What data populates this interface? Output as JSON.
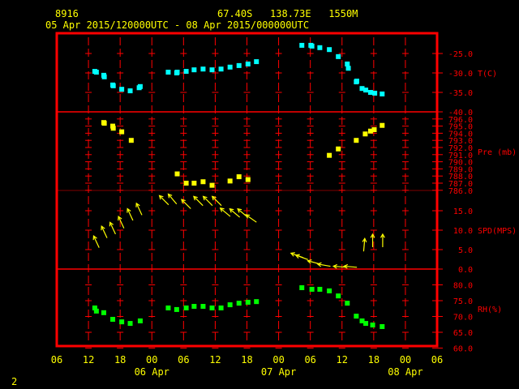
{
  "header": {
    "station": "8916",
    "location": "67.40S   138.73E   1550M",
    "period": "05 Apr 2015/120000UTC - 08 Apr 2015/000000UTC"
  },
  "page_number": "2",
  "colors": {
    "frame": "#ff0000",
    "temp": "#00ffff",
    "pressure": "#ffff00",
    "wind": "#ffff00",
    "rh": "#00ff00",
    "text": "#ffff00"
  },
  "chart_data": [
    {
      "type": "scatter",
      "name": "temperature",
      "ylabel": "T(C)",
      "ylim": [
        -40,
        -19.8
      ],
      "ticks": [
        "-25.0",
        "-30.0",
        "-35.0",
        "-40.0"
      ],
      "tick_values": [
        -25,
        -30,
        -35,
        -40
      ],
      "x_units": "hours since 05 Apr 06UTC",
      "points": [
        [
          7.2,
          -29.6
        ],
        [
          7.5,
          -29.8
        ],
        [
          8.9,
          -30.6
        ],
        [
          9.0,
          -31.0
        ],
        [
          10.6,
          -33.1
        ],
        [
          10.7,
          -33.3
        ],
        [
          12.3,
          -34.2
        ],
        [
          13.9,
          -34.6
        ],
        [
          15.6,
          -33.8
        ],
        [
          15.8,
          -33.5
        ],
        [
          21.1,
          -29.8
        ],
        [
          22.7,
          -30.0
        ],
        [
          22.8,
          -29.8
        ],
        [
          24.5,
          -29.6
        ],
        [
          26.0,
          -29.2
        ],
        [
          27.7,
          -29.0
        ],
        [
          29.4,
          -29.2
        ],
        [
          31.1,
          -29.0
        ],
        [
          32.8,
          -28.5
        ],
        [
          34.5,
          -28.1
        ],
        [
          36.2,
          -27.7
        ],
        [
          37.8,
          -27.1
        ],
        [
          46.4,
          -22.9
        ],
        [
          48.1,
          -22.9
        ],
        [
          48.3,
          -23.1
        ],
        [
          49.8,
          -23.5
        ],
        [
          51.6,
          -24.0
        ],
        [
          53.3,
          -25.8
        ],
        [
          55.0,
          -27.7
        ],
        [
          55.2,
          -28.8
        ],
        [
          56.7,
          -32.3
        ],
        [
          56.8,
          -32.1
        ],
        [
          57.8,
          -34.0
        ],
        [
          58.5,
          -34.4
        ],
        [
          59.4,
          -35.0
        ],
        [
          60.2,
          -35.2
        ],
        [
          61.6,
          -35.4
        ]
      ]
    },
    {
      "type": "scatter",
      "name": "pressure",
      "ylabel": "Pre (mb)",
      "ylim": [
        786,
        797
      ],
      "ticks": [
        "796.0",
        "795.0",
        "794.0",
        "793.0",
        "792.0",
        "791.0",
        "790.0",
        "789.0",
        "788.0",
        "787.0",
        "786.0"
      ],
      "tick_values": [
        796,
        795,
        794,
        793,
        792,
        791,
        790,
        789,
        788,
        787,
        786
      ],
      "points": [
        [
          8.9,
          795.5
        ],
        [
          9.0,
          795.4
        ],
        [
          10.6,
          795.0
        ],
        [
          10.7,
          794.7
        ],
        [
          12.3,
          794.2
        ],
        [
          14.1,
          793.0
        ],
        [
          22.8,
          788.3
        ],
        [
          24.5,
          787.0
        ],
        [
          26.0,
          787.0
        ],
        [
          27.7,
          787.2
        ],
        [
          29.4,
          786.7
        ],
        [
          32.8,
          787.3
        ],
        [
          34.5,
          787.9
        ],
        [
          36.2,
          787.5
        ],
        [
          51.6,
          790.9
        ],
        [
          53.3,
          791.8
        ],
        [
          56.7,
          793.0
        ],
        [
          58.4,
          793.9
        ],
        [
          59.4,
          794.3
        ],
        [
          60.1,
          794.5
        ],
        [
          61.6,
          795.1
        ]
      ]
    },
    {
      "type": "vector",
      "name": "wind",
      "ylabel": "SPD(MPS)",
      "ylim": [
        0,
        20
      ],
      "ticks": [
        "15.0",
        "10.0",
        "5.0",
        "0.0"
      ],
      "tick_values": [
        15,
        10,
        5,
        0
      ],
      "points": [
        [
          7.5,
          7,
          335
        ],
        [
          9.0,
          9.5,
          335
        ],
        [
          10.6,
          10.5,
          335
        ],
        [
          12.2,
          12,
          335
        ],
        [
          13.9,
          14,
          335
        ],
        [
          15.6,
          15.4,
          335
        ],
        [
          20.3,
          17.7,
          315
        ],
        [
          21.9,
          18,
          320
        ],
        [
          24.5,
          16.7,
          315
        ],
        [
          26.8,
          17.5,
          315
        ],
        [
          28.6,
          17.5,
          315
        ],
        [
          30.3,
          17.5,
          315
        ],
        [
          31.9,
          14.6,
          310
        ],
        [
          33.7,
          14.4,
          310
        ],
        [
          35.2,
          14.4,
          310
        ],
        [
          36.8,
          13,
          305
        ],
        [
          45.5,
          3.5,
          290
        ],
        [
          46.4,
          3,
          290
        ],
        [
          48.7,
          1.7,
          285
        ],
        [
          50.6,
          1,
          280
        ],
        [
          53.6,
          0.6,
          275
        ],
        [
          55.6,
          0.6,
          275
        ],
        [
          58.2,
          6.2,
          5
        ],
        [
          59.8,
          7.3,
          0
        ],
        [
          61.7,
          7.3,
          0
        ]
      ]
    },
    {
      "type": "scatter",
      "name": "relative_humidity",
      "ylabel": "RH(%)",
      "ylim": [
        60,
        85
      ],
      "ticks": [
        "80.0",
        "75.0",
        "70.0",
        "65.0",
        "60.0"
      ],
      "tick_values": [
        80,
        75,
        70,
        65,
        60
      ],
      "points": [
        [
          7.2,
          72.7
        ],
        [
          7.5,
          71.7
        ],
        [
          8.9,
          71.2
        ],
        [
          10.6,
          69.1
        ],
        [
          12.3,
          68.3
        ],
        [
          13.9,
          67.8
        ],
        [
          15.8,
          68.6
        ],
        [
          21.1,
          72.7
        ],
        [
          22.7,
          72.2
        ],
        [
          24.5,
          72.7
        ],
        [
          26.0,
          73.2
        ],
        [
          27.7,
          73.2
        ],
        [
          29.4,
          72.7
        ],
        [
          31.1,
          72.7
        ],
        [
          32.8,
          73.7
        ],
        [
          34.5,
          74.2
        ],
        [
          36.2,
          74.5
        ],
        [
          37.8,
          74.7
        ],
        [
          46.4,
          79.1
        ],
        [
          48.3,
          78.6
        ],
        [
          49.8,
          78.6
        ],
        [
          51.6,
          78.1
        ],
        [
          53.3,
          76.5
        ],
        [
          55.0,
          74.2
        ],
        [
          56.7,
          70.1
        ],
        [
          57.8,
          68.6
        ],
        [
          58.5,
          67.8
        ],
        [
          59.8,
          67.3
        ],
        [
          61.6,
          66.8
        ]
      ]
    }
  ],
  "x_axis": {
    "range_hours": [
      0,
      72
    ],
    "tick_labels": [
      "06",
      "12",
      "18",
      "00",
      "06",
      "12",
      "18",
      "00",
      "06",
      "12",
      "18",
      "00",
      "06"
    ],
    "date_labels": [
      {
        "text": "06 Apr",
        "tick": 3
      },
      {
        "text": "07 Apr",
        "tick": 7
      },
      {
        "text": "08 Apr",
        "tick": 11
      }
    ]
  }
}
